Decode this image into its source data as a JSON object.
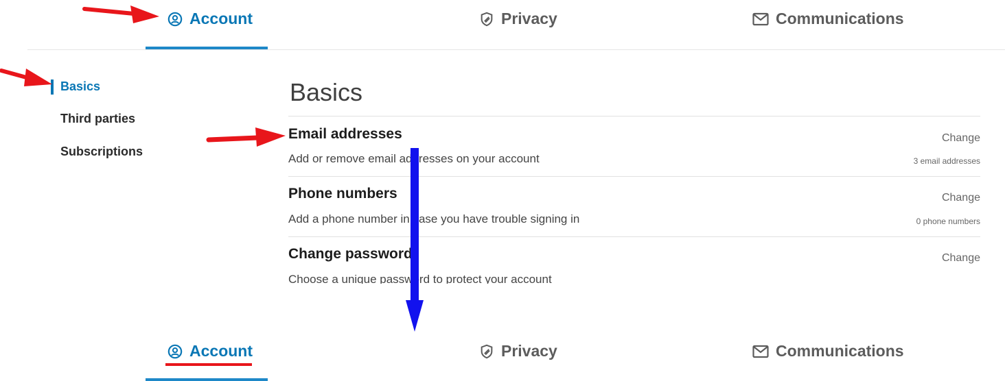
{
  "nav": {
    "tabs": [
      {
        "label": "Account",
        "icon": "user-circle-icon",
        "active": true
      },
      {
        "label": "Privacy",
        "icon": "shield-icon",
        "active": false
      },
      {
        "label": "Communications",
        "icon": "envelope-icon",
        "active": false
      }
    ]
  },
  "sidebar": {
    "items": [
      {
        "label": "Basics",
        "active": true
      },
      {
        "label": "Third parties",
        "active": false
      },
      {
        "label": "Subscriptions",
        "active": false
      }
    ]
  },
  "main": {
    "title": "Basics",
    "rows": [
      {
        "title": "Email addresses",
        "desc": "Add or remove email addresses on your account",
        "action": "Change",
        "meta": "3 email addresses"
      },
      {
        "title": "Phone numbers",
        "desc": "Add a phone number in case you have trouble signing in",
        "action": "Change",
        "meta": "0 phone numbers"
      },
      {
        "title": "Change password",
        "desc": "Choose a unique password to protect your account",
        "action": "Change",
        "meta": ""
      }
    ]
  },
  "colors": {
    "accent": "#0a77b5",
    "annotation_red": "#e8161b",
    "annotation_blue": "#1212ee"
  }
}
